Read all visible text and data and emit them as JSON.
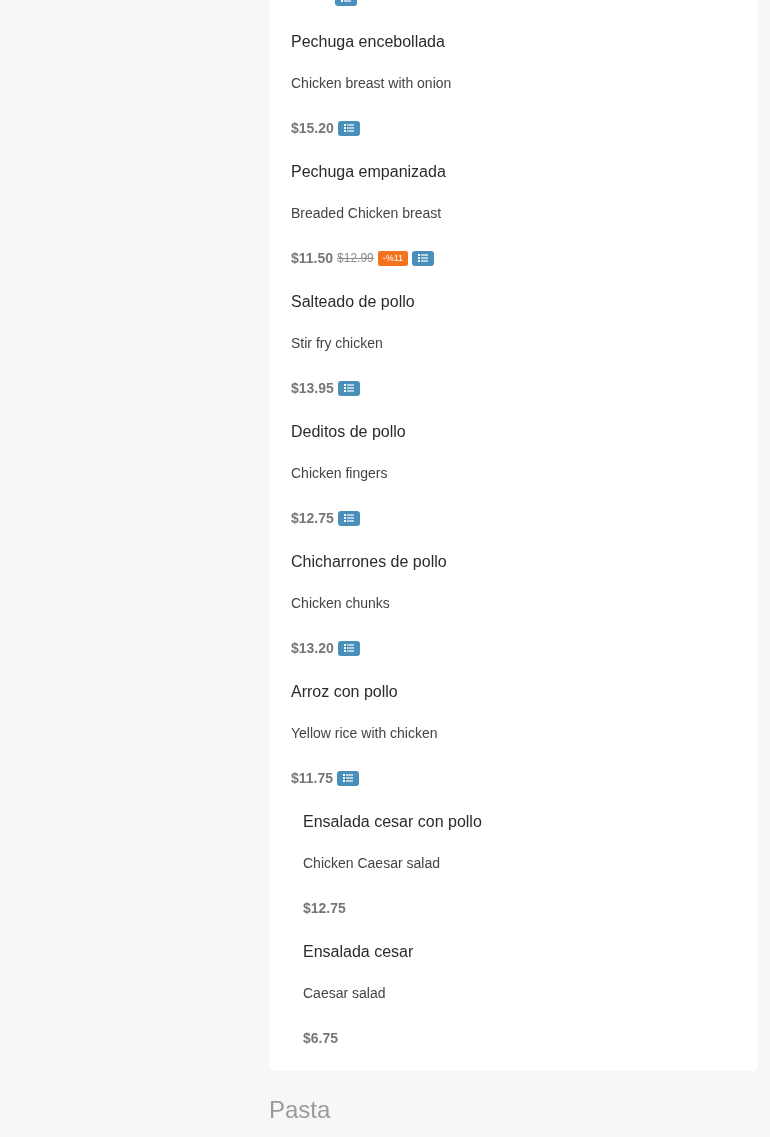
{
  "menu_card": {
    "cut_item": {
      "options": true
    },
    "items": [
      {
        "kind": "main",
        "name": "Pechuga encebollada",
        "description": "Chicken breast with onion",
        "price": "$15.20",
        "options": true
      },
      {
        "kind": "main",
        "name": "Pechuga empanizada",
        "description": "Breaded Chicken breast",
        "price": "$11.50",
        "old_price": "$12.99",
        "discount": "-%11",
        "options": true
      },
      {
        "kind": "main",
        "name": "Salteado de pollo",
        "description": "Stir fry chicken",
        "price": "$13.95",
        "options": true
      },
      {
        "kind": "main",
        "name": "Deditos de pollo",
        "description": "Chicken fingers",
        "price": "$12.75",
        "options": true
      },
      {
        "kind": "main",
        "name": "Chicharrones de pollo",
        "description": "Chicken chunks",
        "price": "$13.20",
        "options": true
      },
      {
        "kind": "main",
        "name": "Arroz con pollo",
        "description": "Yellow rice with chicken",
        "price": "$11.75",
        "options": true
      },
      {
        "kind": "nested",
        "name": "Ensalada cesar con pollo",
        "description": "Chicken Caesar salad",
        "price": "$12.75",
        "options": false
      },
      {
        "kind": "nested",
        "name": "Ensalada cesar",
        "description": "Caesar salad",
        "price": "$6.75",
        "options": false
      }
    ]
  },
  "next_section": {
    "title": "Pasta"
  }
}
